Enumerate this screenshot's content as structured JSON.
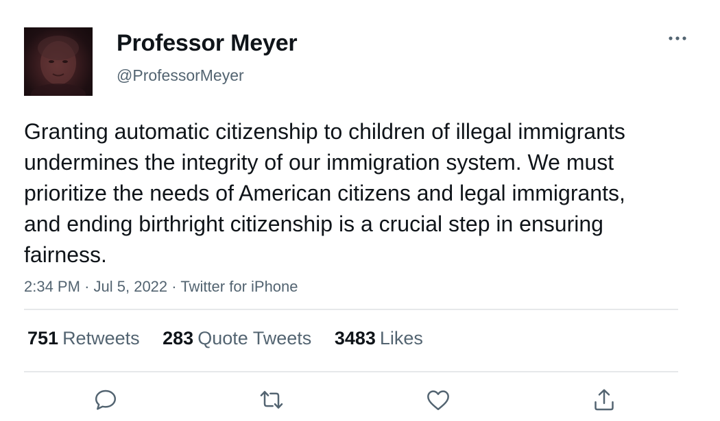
{
  "author": {
    "display_name": "Professor Meyer",
    "handle": "@ProfessorMeyer"
  },
  "tweet": {
    "text": "Granting automatic citizenship to children of illegal immigrants undermines the integrity of our immigration system. We must prioritize the needs of American citizens and legal immigrants, and ending birthright citizenship is a crucial step in ensuring fairness.",
    "time": "2:34 PM",
    "separator": "·",
    "date": "Jul 5, 2022",
    "source": "Twitter for iPhone"
  },
  "stats": {
    "retweets_count": "751",
    "retweets_label": "Retweets",
    "quotes_count": "283",
    "quotes_label": "Quote Tweets",
    "likes_count": "3483",
    "likes_label": "Likes"
  },
  "colors": {
    "text_primary": "#0f1419",
    "text_secondary": "#536471",
    "divider": "#e6e8ea"
  },
  "icons": {
    "more": "more-horizontal-icon",
    "reply": "reply-icon",
    "retweet": "retweet-icon",
    "like": "heart-icon",
    "share": "share-icon"
  }
}
